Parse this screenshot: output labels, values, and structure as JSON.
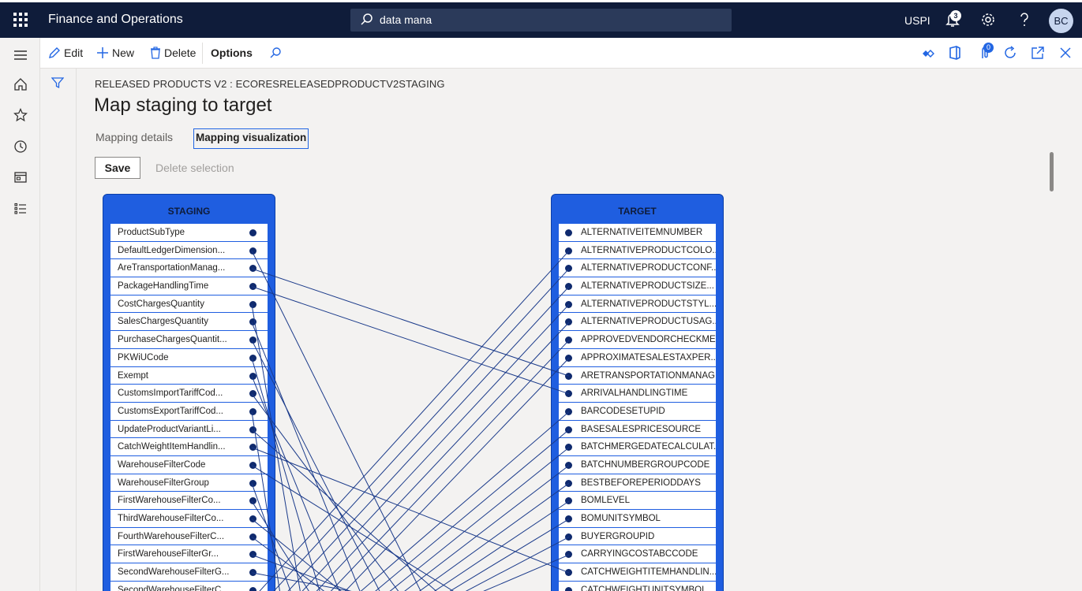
{
  "app": {
    "title": "Finance and Operations"
  },
  "search": {
    "value": "data mana"
  },
  "topbar": {
    "company": "USPI",
    "notification_count": "3",
    "avatar_initials": "BC"
  },
  "action_pane": {
    "edit_label": "Edit",
    "new_label": "New",
    "delete_label": "Delete",
    "options_label": "Options",
    "attachments_count": "0"
  },
  "page": {
    "caption": "RELEASED PRODUCTS V2 : ECORESRELEASEDPRODUCTV2STAGING",
    "title": "Map staging to target",
    "tabs": [
      {
        "label": "Mapping details"
      },
      {
        "label": "Mapping visualization"
      }
    ],
    "save_label": "Save",
    "delete_selection_label": "Delete selection"
  },
  "colors": {
    "navbar": "#0f1c3a",
    "panel": "#1f5ee0",
    "line": "#1a3a8a"
  },
  "staging": {
    "title": "STAGING",
    "fields": [
      "ProductSubType",
      "DefaultLedgerDimension...",
      "AreTransportationManag...",
      "PackageHandlingTime",
      "CostChargesQuantity",
      "SalesChargesQuantity",
      "PurchaseChargesQuantit...",
      "PKWiUCode",
      "Exempt",
      "CustomsImportTariffCod...",
      "CustomsExportTariffCod...",
      "UpdateProductVariantLi...",
      "CatchWeightItemHandlin...",
      "WarehouseFilterCode",
      "WarehouseFilterGroup",
      "FirstWarehouseFilterCo...",
      "ThirdWarehouseFilterCo...",
      "FourthWarehouseFilterC...",
      "FirstWarehouseFilterGr...",
      "SecondWarehouseFilterG...",
      "SecondWarehouseFilterC..."
    ]
  },
  "target": {
    "title": "TARGET",
    "fields": [
      "ALTERNATIVEITEMNUMBER",
      "ALTERNATIVEPRODUCTCOLO...",
      "ALTERNATIVEPRODUCTCONF...",
      "ALTERNATIVEPRODUCTSIZE...",
      "ALTERNATIVEPRODUCTSTYL...",
      "ALTERNATIVEPRODUCTUSAG...",
      "APPROVEDVENDORCHECKMET...",
      "APPROXIMATESALESTAXPER...",
      "ARETRANSPORTATIONMANAG...",
      "ARRIVALHANDLINGTIME",
      "BARCODESETUPID",
      "BASESALESPRICESOURCE",
      "BATCHMERGEDATECALCULAT...",
      "BATCHNUMBERGROUPCODE",
      "BESTBEFOREPERIODDAYS",
      "BOMLEVEL",
      "BOMUNITSYMBOL",
      "BUYERGROUPID",
      "CARRYINGCOSTABCCODE",
      "CATCHWEIGHTITEMHANDLIN...",
      "CATCHWEIGHTUNITSYMBOL"
    ]
  },
  "mappings": [
    [
      1,
      60
    ],
    [
      2,
      8
    ],
    [
      3,
      9
    ],
    [
      4,
      30
    ],
    [
      5,
      45
    ],
    [
      6,
      50
    ],
    [
      7,
      35
    ],
    [
      8,
      40
    ],
    [
      9,
      55
    ],
    [
      10,
      25
    ],
    [
      11,
      65
    ],
    [
      12,
      19
    ],
    [
      13,
      70
    ],
    [
      14,
      28
    ],
    [
      15,
      33
    ],
    [
      16,
      42
    ],
    [
      17,
      38
    ],
    [
      18,
      47
    ],
    [
      19,
      52
    ],
    [
      60,
      1
    ],
    [
      61,
      2
    ],
    [
      62,
      3
    ],
    [
      63,
      4
    ],
    [
      64,
      5
    ],
    [
      65,
      6
    ],
    [
      66,
      7
    ],
    [
      67,
      10
    ],
    [
      68,
      11
    ],
    [
      69,
      12
    ],
    [
      70,
      13
    ],
    [
      71,
      14
    ],
    [
      72,
      15
    ],
    [
      73,
      16
    ],
    [
      74,
      17
    ],
    [
      75,
      18
    ]
  ]
}
